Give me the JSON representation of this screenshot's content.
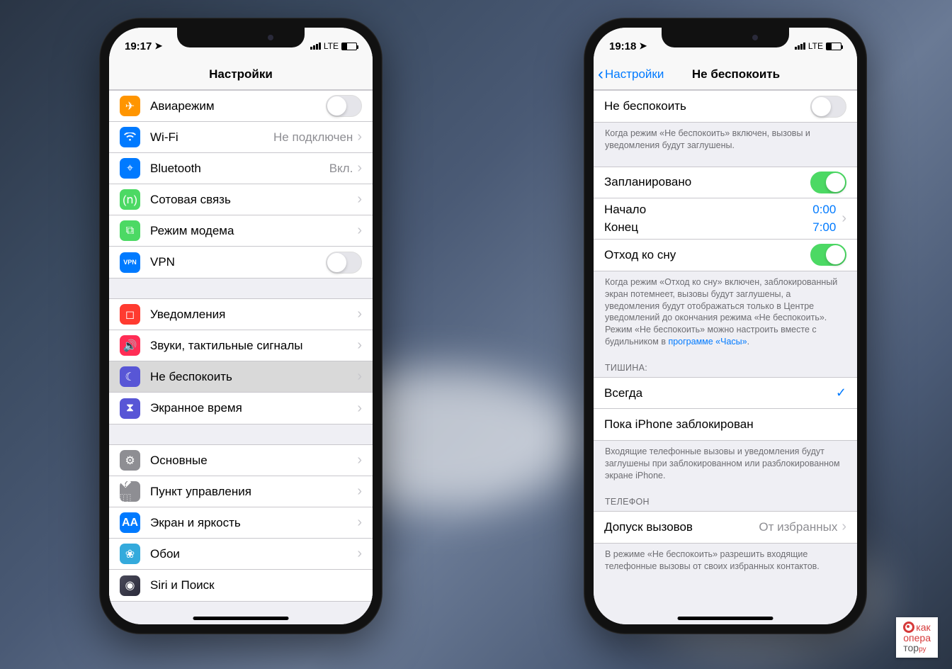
{
  "phone1": {
    "status": {
      "time": "19:17",
      "network": "LTE"
    },
    "nav": {
      "title": "Настройки"
    },
    "g1": [
      {
        "label": "Авиарежим",
        "icon": "airplane",
        "color": "bg-orange",
        "control": "toggle-off"
      },
      {
        "label": "Wi-Fi",
        "icon": "wifi",
        "color": "bg-blue",
        "detail": "Не подключен",
        "control": "disclosure"
      },
      {
        "label": "Bluetooth",
        "icon": "bluetooth",
        "color": "bg-blue",
        "detail": "Вкл.",
        "control": "disclosure"
      },
      {
        "label": "Сотовая связь",
        "icon": "antenna",
        "color": "bg-green",
        "control": "disclosure"
      },
      {
        "label": "Режим модема",
        "icon": "link",
        "color": "bg-green",
        "control": "disclosure"
      },
      {
        "label": "VPN",
        "icon": "vpn",
        "color": "bg-vpn",
        "control": "toggle-off"
      }
    ],
    "g2": [
      {
        "label": "Уведомления",
        "icon": "bell",
        "color": "bg-red",
        "control": "disclosure"
      },
      {
        "label": "Звуки, тактильные сигналы",
        "icon": "speaker",
        "color": "bg-pink",
        "control": "disclosure"
      },
      {
        "label": "Не беспокоить",
        "icon": "moon",
        "color": "bg-purple",
        "control": "disclosure",
        "selected": true
      },
      {
        "label": "Экранное время",
        "icon": "hourglass",
        "color": "bg-purple",
        "control": "disclosure"
      }
    ],
    "g3": [
      {
        "label": "Основные",
        "icon": "gear",
        "color": "bg-gray",
        "control": "disclosure"
      },
      {
        "label": "Пункт управления",
        "icon": "sliders",
        "color": "bg-gray",
        "control": "disclosure"
      },
      {
        "label": "Экран и яркость",
        "icon": "text",
        "color": "bg-blue",
        "control": "disclosure"
      },
      {
        "label": "Обои",
        "icon": "flower",
        "color": "bg-teal",
        "control": "disclosure"
      },
      {
        "label": "Siri и Поиск",
        "icon": "siri",
        "color": "bg-gray",
        "control": "disclosure"
      }
    ]
  },
  "phone2": {
    "status": {
      "time": "19:18",
      "network": "LTE"
    },
    "nav": {
      "back": "Настройки",
      "title": "Не беспокоить"
    },
    "dnd": {
      "label": "Не беспокоить",
      "footer": "Когда режим «Не беспокоить» включен, вызовы и уведомления будут заглушены."
    },
    "schedule": {
      "label": "Запланировано",
      "from_label": "Начало",
      "from_value": "0:00",
      "to_label": "Конец",
      "to_value": "7:00",
      "bedtime_label": "Отход ко сну",
      "footer_pre": "Когда режим «Отход ко сну» включен, заблокированный экран потемнеет, вызовы будут заглушены, а уведомления будут отображаться только в Центре уведомлений до окончания режима «Не беспокоить». Режим «Не беспокоить» можно настроить вместе с будильником в ",
      "footer_link": "программе «Часы»",
      "footer_post": "."
    },
    "silence": {
      "header": "ТИШИНА:",
      "opt1": "Всегда",
      "opt2": "Пока iPhone заблокирован",
      "footer": "Входящие телефонные вызовы и уведомления будут заглушены при заблокированном или разблокированном экране iPhone."
    },
    "phone_section": {
      "header": "ТЕЛЕФОН",
      "allow_label": "Допуск вызовов",
      "allow_value": "От избранных",
      "footer": "В режиме «Не беспокоить» разрешить входящие телефонные вызовы от своих избранных контактов."
    }
  },
  "watermark": {
    "line1": "как",
    "line2": "опера",
    "line3": "тор",
    "suffix": "ру"
  }
}
